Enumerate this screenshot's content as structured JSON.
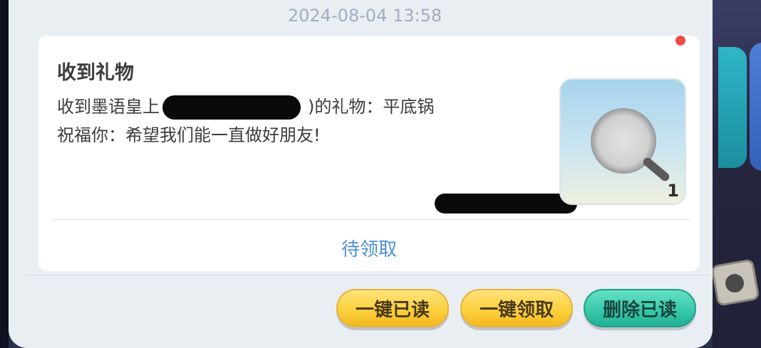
{
  "timestamp": "2024-08-04 13:58",
  "message": {
    "title": "收到礼物",
    "line1_prefix": "收到墨语皇上",
    "line1_suffix": ")的礼物：平底锅",
    "line2": "祝福你：希望我们能一直做好朋友!",
    "item": {
      "icon": "frying-pan-icon",
      "count": "1"
    },
    "status": "待领取"
  },
  "buttons": {
    "read_all": "一键已读",
    "claim_all": "一键领取",
    "delete_read": "删除已读"
  },
  "colors": {
    "panel": "#e9eef3",
    "status_link": "#4a90d9",
    "unread_dot": "#ee4b4b",
    "gold_button": "#fbcf3a",
    "teal_button": "#37c7aa"
  }
}
